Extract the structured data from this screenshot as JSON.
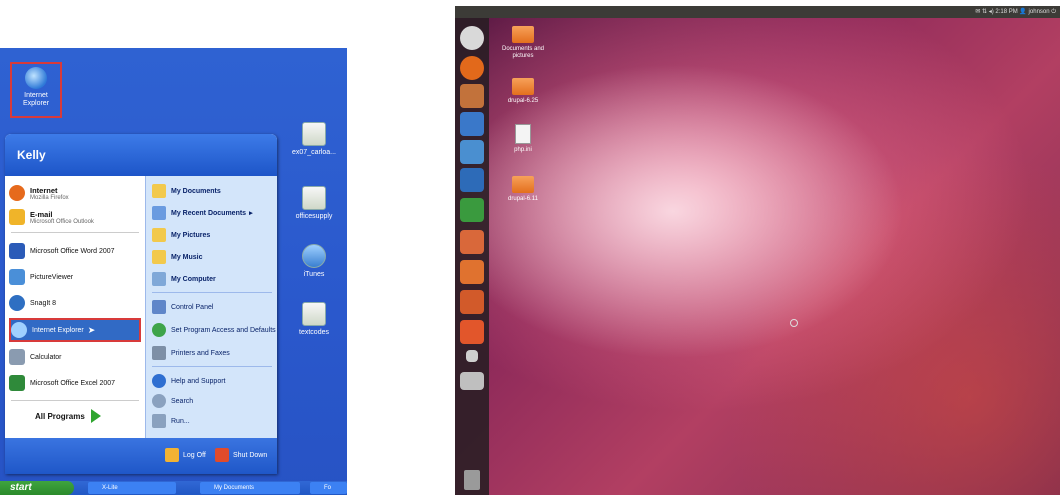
{
  "xp": {
    "desktop_icon_ie": "Internet Explorer",
    "desktop_right_icons": [
      "ex07_carloa...",
      "officesupply",
      "iTunes",
      "textcodes"
    ],
    "user_name": "Kelly",
    "pinned": [
      {
        "label": "Internet",
        "sub": "Mozilla Firefox",
        "icon": "firefox-icon",
        "color": "#e66a1c"
      },
      {
        "label": "E-mail",
        "sub": "Microsoft Office Outlook",
        "icon": "outlook-icon",
        "color": "#f0b429"
      }
    ],
    "recent": [
      {
        "label": "Microsoft Office Word 2007",
        "icon": "word-icon",
        "color": "#2b5bb8"
      },
      {
        "label": "PictureViewer",
        "icon": "pictureviewer-icon",
        "color": "#4a8fd8"
      },
      {
        "label": "SnagIt 8",
        "icon": "snagit-icon",
        "color": "#2e6fc2"
      },
      {
        "label": "Internet Explorer",
        "icon": "internet-explorer-icon",
        "color": "#3f8fe0"
      },
      {
        "label": "Calculator",
        "icon": "calculator-icon",
        "color": "#8a9bb0"
      },
      {
        "label": "Microsoft Office Excel 2007",
        "icon": "excel-icon",
        "color": "#2f8a3a"
      }
    ],
    "all_programs": "All Programs",
    "places": [
      {
        "label": "My Documents",
        "icon": "folder-icon",
        "bold": true,
        "color": "#f2c94c"
      },
      {
        "label": "My Recent Documents",
        "icon": "recent-docs-icon",
        "bold": true,
        "color": "#6a9be0",
        "arrow": "▸"
      },
      {
        "label": "My Pictures",
        "icon": "pictures-icon",
        "bold": true,
        "color": "#f2c94c"
      },
      {
        "label": "My Music",
        "icon": "music-icon",
        "bold": true,
        "color": "#f2c94c"
      },
      {
        "label": "My Computer",
        "icon": "computer-icon",
        "bold": true,
        "color": "#7fa8d8"
      }
    ],
    "settings": [
      {
        "label": "Control Panel",
        "icon": "control-panel-icon",
        "color": "#5f86c9"
      },
      {
        "label": "Set Program Access and Defaults",
        "icon": "defaults-icon",
        "color": "#3ea44a"
      },
      {
        "label": "Printers and Faxes",
        "icon": "printer-icon",
        "color": "#7d8fa6"
      }
    ],
    "help": [
      {
        "label": "Help and Support",
        "icon": "help-icon",
        "color": "#2f6fd1"
      },
      {
        "label": "Search",
        "icon": "search-icon",
        "color": "#8aa1bf"
      },
      {
        "label": "Run...",
        "icon": "run-icon",
        "color": "#8aa1bf"
      }
    ],
    "log_off": "Log Off",
    "shut_down": "Shut Down",
    "start": "start",
    "taskbar_items": [
      "X-Lite",
      "My Documents",
      "Fo"
    ]
  },
  "ubuntu": {
    "indicators": "✉  ⇅  ◂)  2:18 PM  👤 johnson  ⏻",
    "launcher_icons": [
      {
        "icon": "dash-home-icon",
        "color": "#d9d9d9"
      },
      {
        "icon": "firefox-icon",
        "color": "#e2691b"
      },
      {
        "icon": "files-icon",
        "color": "#c2723b"
      },
      {
        "icon": "writer-icon",
        "color": "#3a78c9"
      },
      {
        "icon": "chromium-icon",
        "color": "#4a8fd0"
      },
      {
        "icon": "text-icon",
        "color": "#2d6bb8"
      },
      {
        "icon": "calc-icon",
        "color": "#3a9a3e"
      },
      {
        "icon": "impress-icon",
        "color": "#d9683a"
      },
      {
        "icon": "software-center-icon",
        "color": "#e0722f"
      },
      {
        "icon": "settings-icon",
        "color": "#d25a2a"
      },
      {
        "icon": "ubuntu-one-icon",
        "color": "#e2562b"
      },
      {
        "icon": "workspace-icon",
        "color": "#cfcfcf"
      },
      {
        "icon": "terminal-icon",
        "color": "#bfbfbf"
      },
      {
        "icon": "trash-icon",
        "color": "#9a9a9a"
      }
    ],
    "desktop_icons": [
      {
        "label": "Documents and pictures",
        "type": "folder"
      },
      {
        "label": "drupal-6.25",
        "type": "folder"
      },
      {
        "label": "php.ini",
        "type": "file"
      },
      {
        "label": "drupal-6.11",
        "type": "folder"
      }
    ]
  }
}
